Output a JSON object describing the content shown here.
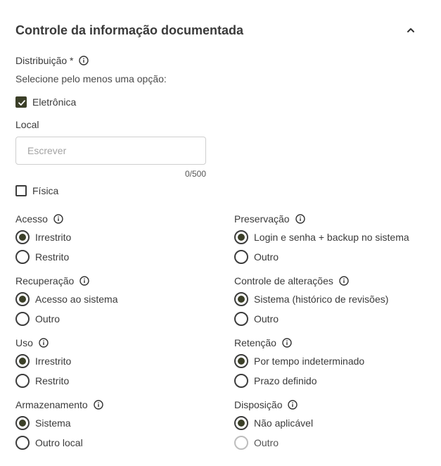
{
  "section": {
    "title": "Controle da informação documentada"
  },
  "distribution": {
    "label": "Distribuição *",
    "helper": "Selecione pelo menos uma opção:",
    "electronic": {
      "label": "Eletrônica",
      "checked": true
    },
    "local": {
      "label": "Local",
      "placeholder": "Escrever",
      "value": "",
      "counter": "0/500"
    },
    "physical": {
      "label": "Física",
      "checked": false
    }
  },
  "groups": {
    "acesso": {
      "label": "Acesso",
      "options": [
        "Irrestrito",
        "Restrito"
      ],
      "selected": 0
    },
    "preservacao": {
      "label": "Preservação",
      "options": [
        "Login e senha + backup no sistema",
        "Outro"
      ],
      "selected": 0
    },
    "recuperacao": {
      "label": "Recuperação",
      "options": [
        "Acesso ao sistema",
        "Outro"
      ],
      "selected": 0
    },
    "controle": {
      "label": "Controle de alterações",
      "options": [
        "Sistema (histórico de revisões)",
        "Outro"
      ],
      "selected": 0
    },
    "uso": {
      "label": "Uso",
      "options": [
        "Irrestrito",
        "Restrito"
      ],
      "selected": 0
    },
    "retencao": {
      "label": "Retenção",
      "options": [
        "Por tempo indeterminado",
        "Prazo definido"
      ],
      "selected": 0
    },
    "armazenamento": {
      "label": "Armazenamento",
      "options": [
        "Sistema",
        "Outro local"
      ],
      "selected": 0
    },
    "disposicao": {
      "label": "Disposição",
      "options": [
        "Não aplicável",
        "Outro"
      ],
      "selected": 0,
      "disabled_option": 1
    }
  },
  "colors": {
    "accent": "#3b3f28",
    "border": "#3d3d3d",
    "text": "#3a3a3a"
  }
}
